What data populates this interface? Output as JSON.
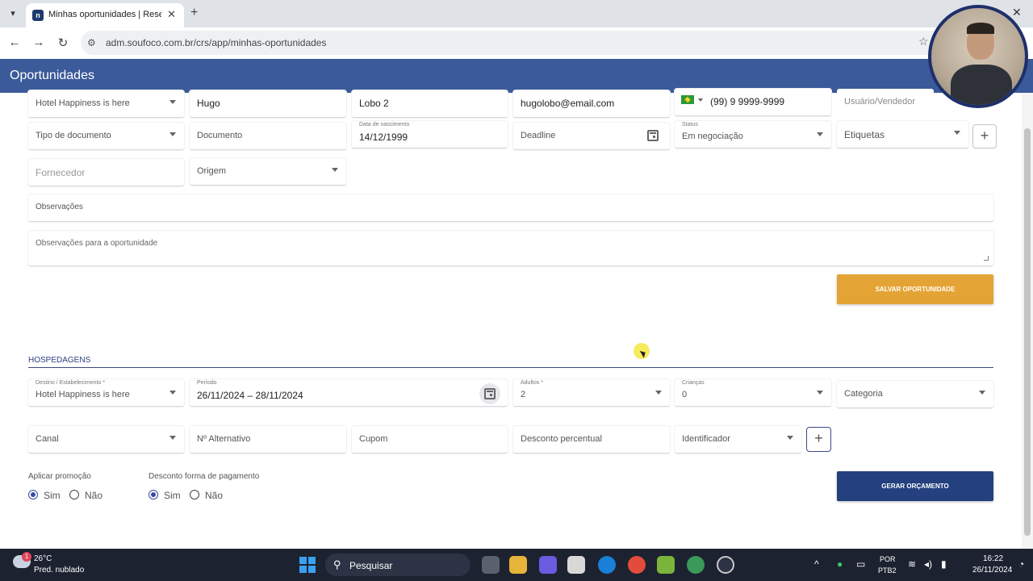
{
  "browser": {
    "tab_title": "Minhas oportunidades | Reserva",
    "url": "adm.soufoco.com.br/crs/app/minhas-oportunidades"
  },
  "app": {
    "title": "Oportunidades"
  },
  "form": {
    "hotel": "Hotel Happiness is here",
    "first_name": "Hugo",
    "last_name": "Lobo 2",
    "email": "hugolobo@email.com",
    "phone": "(99) 9 9999-9999",
    "user_seller": "Usuário/Vendedor",
    "doc_type": "Tipo de documento",
    "document": "Documento",
    "birth_label": "Data de nascimento",
    "birth_value": "14/12/1999",
    "deadline": "Deadline",
    "status_label": "Status",
    "status_value": "Em negociação",
    "tags": "Etiquetas",
    "supplier": "Fornecedor",
    "origin": "Origem",
    "observations": "Observações",
    "opportunity_notes": "Observações para a oportunidade",
    "save_button": "SALVAR OPORTUNIDADE"
  },
  "lodging": {
    "section_title": "HOSPEDAGENS",
    "destination_label": "Destino / Estabelecimento *",
    "destination_value": "Hotel Happiness is here",
    "period_label": "Período",
    "period_value": "26/11/2024 – 28/11/2024",
    "adults_label": "Adultos *",
    "adults_value": "2",
    "children_label": "Crianças",
    "children_value": "0",
    "category": "Categoria",
    "channel": "Canal",
    "alt_number": "Nº Alternativo",
    "coupon": "Cupom",
    "percent_discount": "Desconto percentual",
    "identifier": "Identificador",
    "apply_promo_label": "Aplicar promoção",
    "payment_discount_label": "Desconto forma de pagamento",
    "yes": "Sim",
    "no": "Não",
    "generate_button": "GERAR ORÇAMENTO"
  },
  "taskbar": {
    "temperature": "26°C",
    "weather": "Pred. nublado",
    "weather_badge": "1",
    "search": "Pesquisar",
    "lang_1": "POR",
    "lang_2": "PTB2",
    "time": "16:22",
    "date": "26/11/2024"
  },
  "icons": {
    "window_close": "close-icon",
    "browser_star": "star-icon"
  }
}
